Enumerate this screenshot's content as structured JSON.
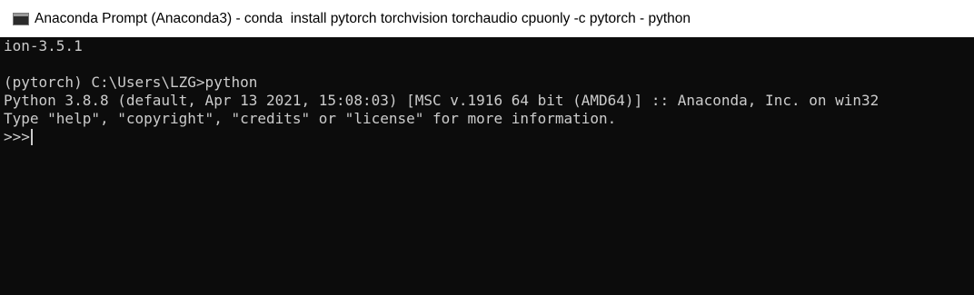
{
  "window": {
    "title": "Anaconda Prompt (Anaconda3) - conda  install pytorch torchvision torchaudio cpuonly -c pytorch - python",
    "icon": "console-window-icon"
  },
  "console": {
    "lines": [
      "ion-3.5.1",
      "",
      "(pytorch) C:\\Users\\LZG>python",
      "Python 3.8.8 (default, Apr 13 2021, 15:08:03) [MSC v.1916 64 bit (AMD64)] :: Anaconda, Inc. on win32",
      "Type \"help\", \"copyright\", \"credits\" or \"license\" for more information."
    ],
    "prompt": ">>>"
  },
  "colors": {
    "console_bg": "#0c0c0c",
    "console_text": "#cccccc",
    "titlebar_bg": "#ffffff"
  }
}
